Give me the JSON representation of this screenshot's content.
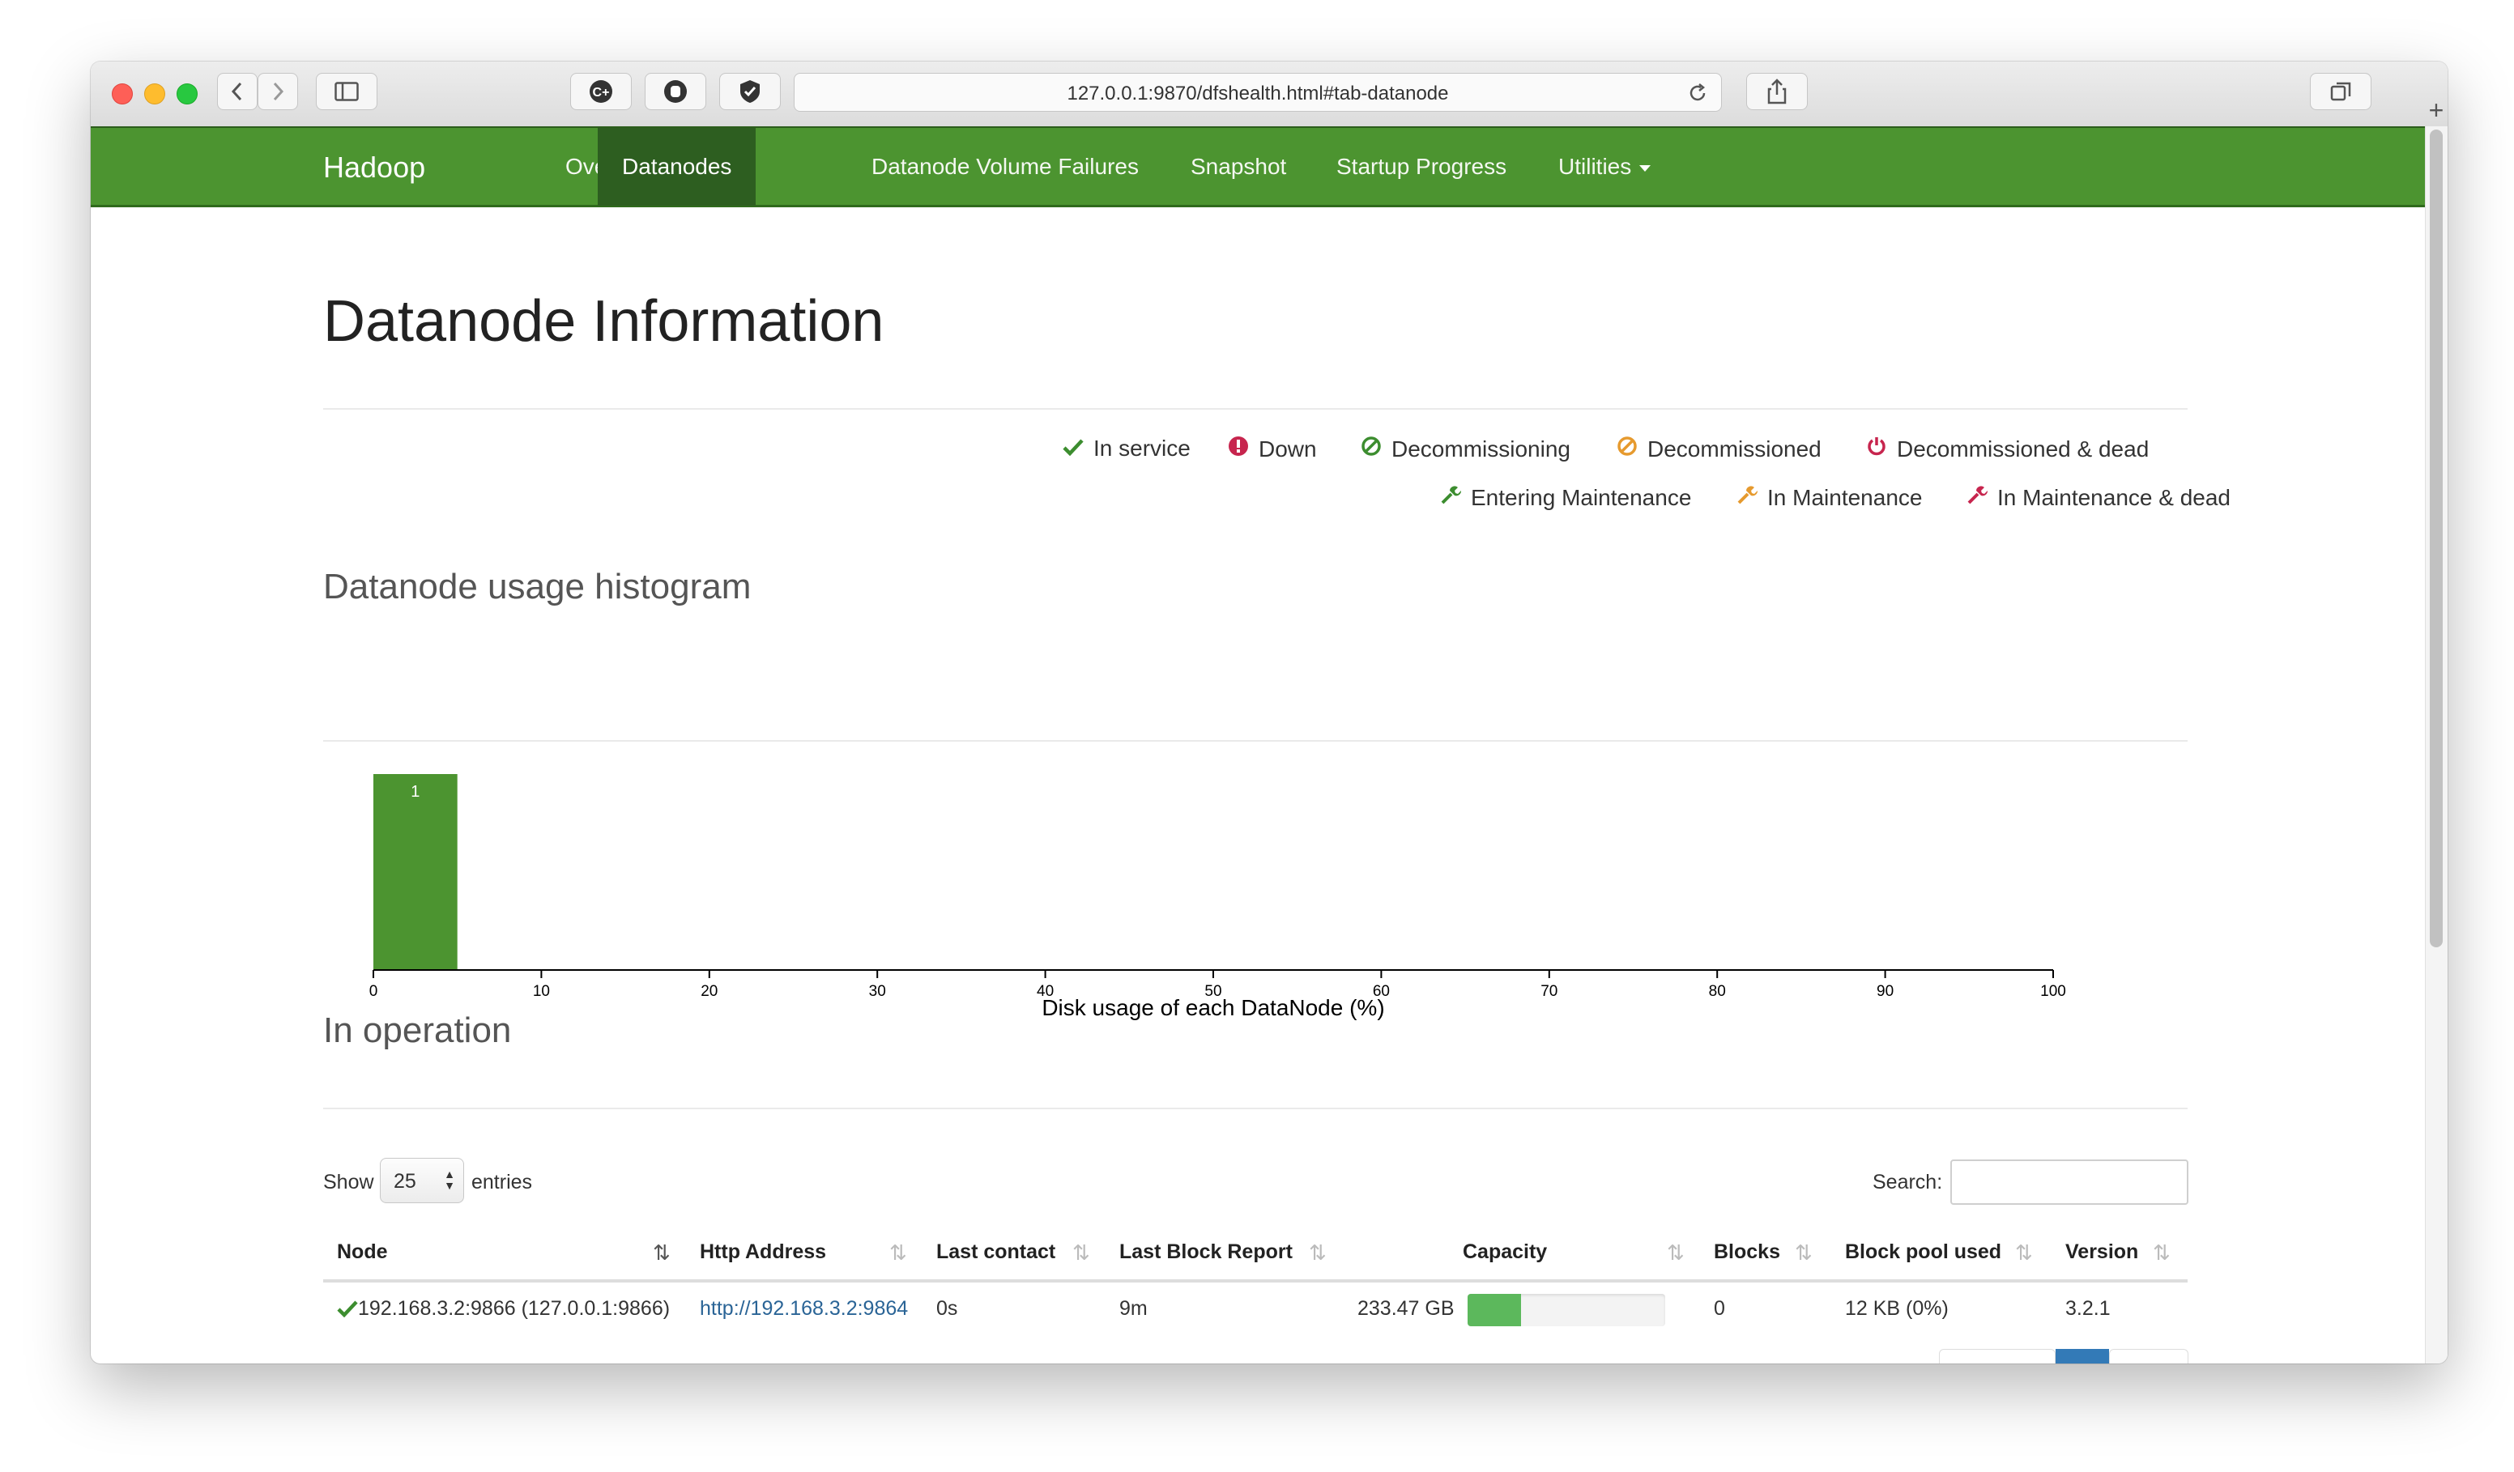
{
  "browser": {
    "url": "127.0.0.1:9870/dfshealth.html#tab-datanode"
  },
  "navbar": {
    "brand": "Hadoop",
    "items": [
      {
        "label": "Overview"
      },
      {
        "label": "Datanodes",
        "active": true
      },
      {
        "label": "Datanode Volume Failures"
      },
      {
        "label": "Snapshot"
      },
      {
        "label": "Startup Progress"
      },
      {
        "label": "Utilities"
      }
    ]
  },
  "page": {
    "title": "Datanode Information"
  },
  "legend": [
    {
      "label": "In service",
      "icon": "check-icon",
      "color": "#3c8d2f"
    },
    {
      "label": "Down",
      "icon": "exclamation-circle-icon",
      "color": "#c7254e"
    },
    {
      "label": "Decommissioning",
      "icon": "ban-icon",
      "color": "#3c8d2f"
    },
    {
      "label": "Decommissioned",
      "icon": "ban-icon",
      "color": "#e69a2e"
    },
    {
      "label": "Decommissioned & dead",
      "icon": "power-icon",
      "color": "#c7254e"
    },
    {
      "label": "Entering Maintenance",
      "icon": "wrench-icon",
      "color": "#3c8d2f"
    },
    {
      "label": "In Maintenance",
      "icon": "wrench-icon",
      "color": "#e69a2e"
    },
    {
      "label": "In Maintenance & dead",
      "icon": "wrench-icon",
      "color": "#c7254e"
    }
  ],
  "histogram": {
    "heading": "Datanode usage histogram"
  },
  "chart_data": {
    "type": "bar",
    "title": "",
    "xlabel": "Disk usage of each DataNode (%)",
    "ylabel": "",
    "x_ticks": [
      0,
      10,
      20,
      30,
      40,
      50,
      60,
      70,
      80,
      90,
      100
    ],
    "xlim": [
      0,
      100
    ],
    "bins": [
      {
        "start": 0,
        "end": 5,
        "count": 1
      }
    ],
    "data_labels": [
      "1"
    ],
    "bar_color": "#4c9430",
    "grid": false
  },
  "operation": {
    "heading": "In operation",
    "show_label": "Show",
    "entries_value": "25",
    "entries_label": "entries",
    "search_label": "Search:",
    "search_value": "",
    "columns": [
      "Node",
      "Http Address",
      "Last contact",
      "Last Block Report",
      "Capacity",
      "Blocks",
      "Block pool used",
      "Version"
    ],
    "rows": [
      {
        "node": "192.168.3.2:9866 (127.0.0.1:9866)",
        "http": "http://192.168.3.2:9864",
        "last_contact": "0s",
        "last_block_report": "9m",
        "capacity": "233.47 GB",
        "capacity_used_fraction": 0.27,
        "blocks": "0",
        "block_pool_used": "12 KB (0%)",
        "version": "3.2.1"
      }
    ]
  }
}
